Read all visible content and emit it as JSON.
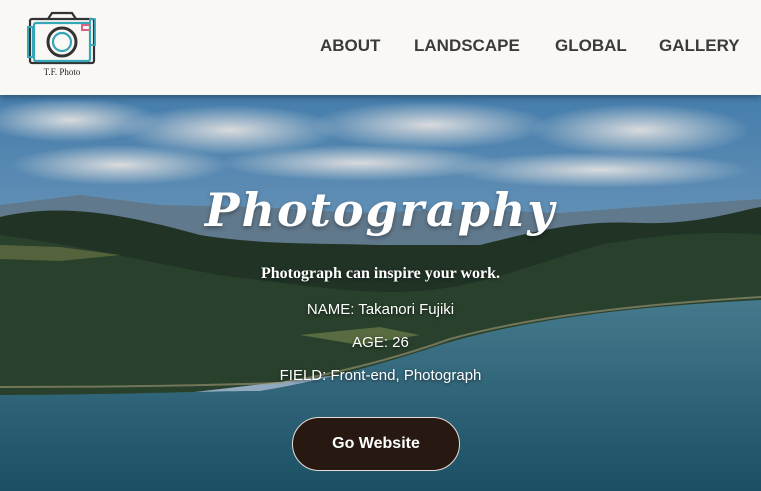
{
  "header": {
    "logo_text": "T.F. Photo",
    "nav": [
      {
        "label": "ABOUT"
      },
      {
        "label": "LANDSCAPE"
      },
      {
        "label": "GLOBAL"
      },
      {
        "label": "GALLERY"
      }
    ]
  },
  "hero": {
    "title": "Photography",
    "tagline": "Photograph can inspire your work.",
    "name_line": "NAME: Takanori Fujiki",
    "age_line": "AGE: 26",
    "field_line": "FIELD: Front-end, Photograph",
    "button_label": "Go Website"
  },
  "colors": {
    "header_bg": "#faf8f4",
    "nav_text": "#3b3b3b",
    "button_bg": "#271812",
    "logo_teal": "#35a7b8",
    "logo_pink": "#e0607e"
  }
}
